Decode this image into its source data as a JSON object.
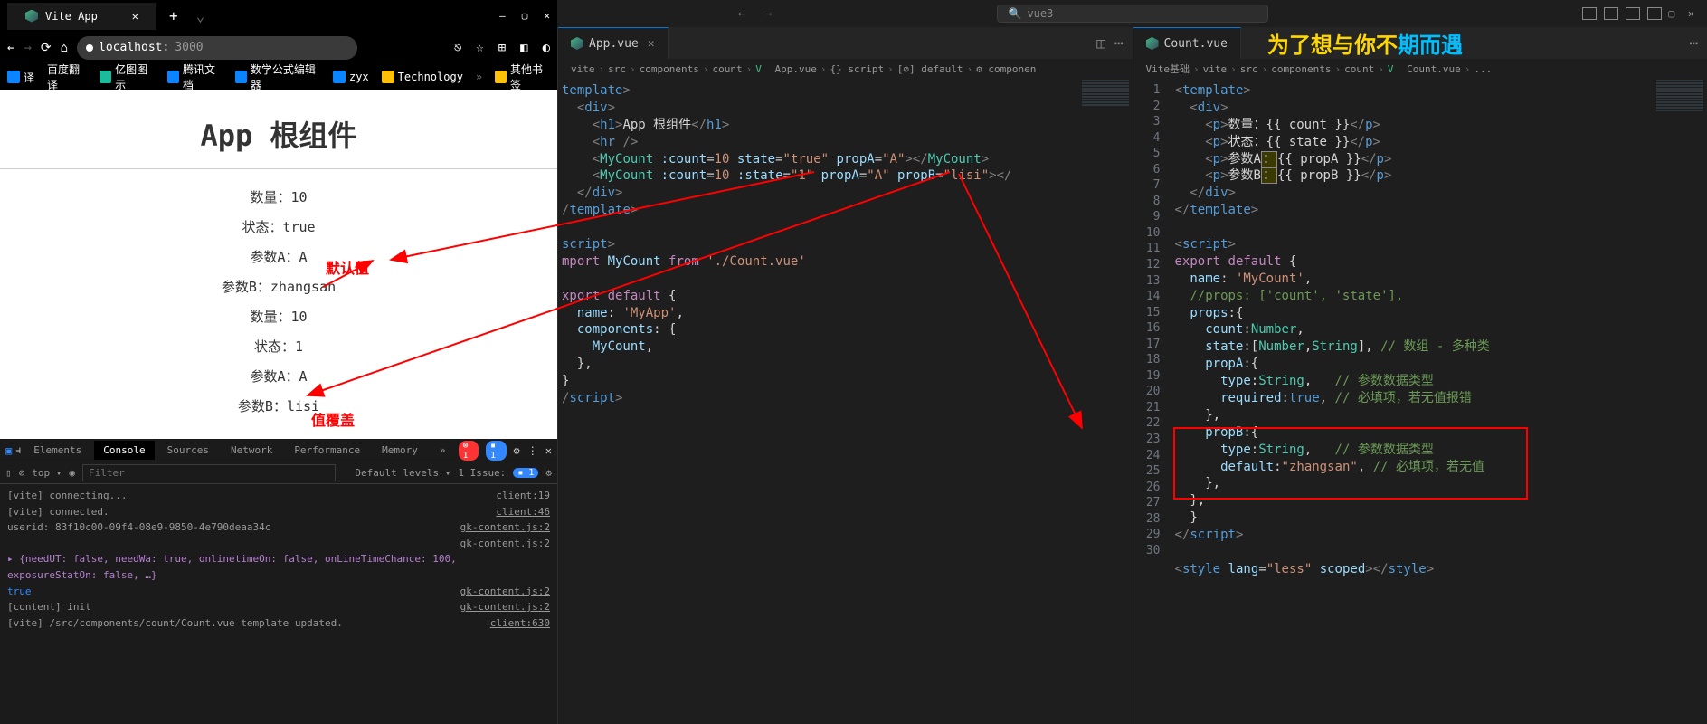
{
  "browser": {
    "tab_title": "Vite App",
    "url_host": "localhost:",
    "url_port": "3000",
    "bookmarks": [
      {
        "label": "译",
        "color": "#0a84ff"
      },
      {
        "label": "百度翻译",
        "color": "#0a84ff"
      },
      {
        "label": "亿图图示",
        "color": "#1abc9c"
      },
      {
        "label": "腾讯文档",
        "color": "#0a84ff"
      },
      {
        "label": "数学公式编辑器",
        "color": "#0a84ff"
      },
      {
        "label": "zyx",
        "color": "#0a84ff"
      },
      {
        "label": "Technology",
        "color": "#ffc107"
      },
      {
        "label": "其他书签",
        "color": "#ffc107"
      }
    ]
  },
  "page": {
    "h1": "App 根组件",
    "lines": [
      "数量：10",
      "状态：true",
      "参数A：A",
      "参数B：zhangsan",
      "数量：10",
      "状态：1",
      "参数A：A",
      "参数B：lisi"
    ]
  },
  "annotation": {
    "default": "默认值",
    "override": "值覆盖"
  },
  "devtools": {
    "tabs": [
      "Elements",
      "Console",
      "Sources",
      "Network",
      "Performance",
      "Memory"
    ],
    "filter_placeholder": "Filter",
    "levels": "Default levels ▾",
    "issues": "1 Issue: ",
    "dropdown": "top ▾",
    "logs": [
      {
        "msg": "[vite] connecting...",
        "src": "client:19"
      },
      {
        "msg": "[vite] connected.",
        "src": "client:46"
      },
      {
        "msg": "userid: 83f10c00-09f4-08e9-9850-4e790deaa34c",
        "src": "gk-content.js:2"
      },
      {
        "msg": "",
        "src": "gk-content.js:2"
      },
      {
        "msg": "▸ {needUT: false, needWa: true, onlinetimeOn: false, onLineTimeChance: 100, exposureStatOn: false, …}",
        "src": ""
      },
      {
        "msg": "true",
        "src": "gk-content.js:2",
        "cls": "blue"
      },
      {
        "msg": "[content] init",
        "src": "gk-content.js:2"
      },
      {
        "msg": "[vite] /src/components/count/Count.vue template updated.",
        "src": "client:630"
      }
    ]
  },
  "vscode": {
    "search": "vue3",
    "left": {
      "tab": "App.vue",
      "breadcrumb": [
        "vite",
        "src",
        "components",
        "count",
        "App.vue",
        "{} script",
        "[⊘] default",
        "⚙ componen"
      ],
      "code": "template>\n  <div>\n    <h1>App 根组件</h1>\n    <hr />\n    <MyCount :count=10 state=\"true\" propA=\"A\"></MyCount>\n    <MyCount :count=10 :state=\"1\" propA=\"A\" propB=\"lisi\"></\n  </div>\n/template>\n\nscript>\nmport MyCount from './Count.vue'\n\nxport default {\n  name: 'MyApp',\n  components: {\n    MyCount,\n  },\n}\n/script>"
    },
    "right": {
      "tab": "Count.vue",
      "breadcrumb": [
        "Vite基础",
        "vite",
        "src",
        "components",
        "count",
        "Count.vue",
        "..."
      ],
      "lines": 30
    }
  },
  "watermark": {
    "a": "为了想与你不",
    "b": "期而遇"
  }
}
